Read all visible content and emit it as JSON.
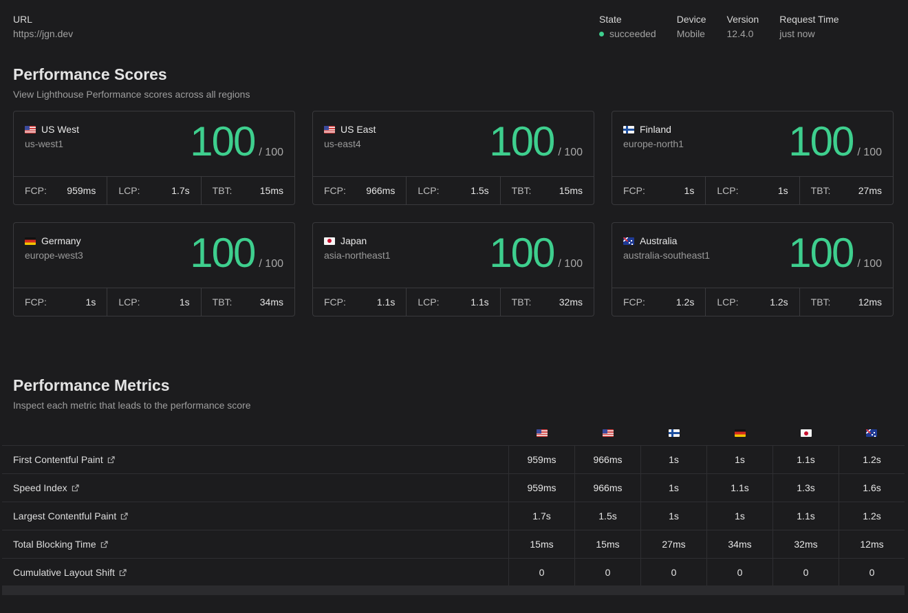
{
  "header": {
    "url_label": "URL",
    "url_value": "https://jgn.dev",
    "state_label": "State",
    "state_value": "succeeded",
    "device_label": "Device",
    "device_value": "Mobile",
    "version_label": "Version",
    "version_value": "12.4.0",
    "request_time_label": "Request Time",
    "request_time_value": "just now"
  },
  "scores_section": {
    "title": "Performance Scores",
    "subtitle": "View Lighthouse Performance scores across all regions",
    "max_suffix": "/ 100",
    "fcp_label": "FCP:",
    "lcp_label": "LCP:",
    "tbt_label": "TBT:",
    "regions": [
      {
        "name": "US West",
        "code": "us-west1",
        "flag": "flag-us",
        "score": "100",
        "fcp": "959ms",
        "lcp": "1.7s",
        "tbt": "15ms"
      },
      {
        "name": "US East",
        "code": "us-east4",
        "flag": "flag-us",
        "score": "100",
        "fcp": "966ms",
        "lcp": "1.5s",
        "tbt": "15ms"
      },
      {
        "name": "Finland",
        "code": "europe-north1",
        "flag": "flag-fi",
        "score": "100",
        "fcp": "1s",
        "lcp": "1s",
        "tbt": "27ms"
      },
      {
        "name": "Germany",
        "code": "europe-west3",
        "flag": "flag-de",
        "score": "100",
        "fcp": "1s",
        "lcp": "1s",
        "tbt": "34ms"
      },
      {
        "name": "Japan",
        "code": "asia-northeast1",
        "flag": "flag-jp",
        "score": "100",
        "fcp": "1.1s",
        "lcp": "1.1s",
        "tbt": "32ms"
      },
      {
        "name": "Australia",
        "code": "australia-southeast1",
        "flag": "flag-au",
        "score": "100",
        "fcp": "1.2s",
        "lcp": "1.2s",
        "tbt": "12ms"
      }
    ]
  },
  "metrics_section": {
    "title": "Performance Metrics",
    "subtitle": "Inspect each metric that leads to the performance score",
    "column_flags": [
      "flag-us",
      "flag-us",
      "flag-fi",
      "flag-de",
      "flag-jp",
      "flag-au"
    ],
    "rows": [
      {
        "label": "First Contentful Paint",
        "values": [
          "959ms",
          "966ms",
          "1s",
          "1s",
          "1.1s",
          "1.2s"
        ]
      },
      {
        "label": "Speed Index",
        "values": [
          "959ms",
          "966ms",
          "1s",
          "1.1s",
          "1.3s",
          "1.6s"
        ]
      },
      {
        "label": "Largest Contentful Paint",
        "values": [
          "1.7s",
          "1.5s",
          "1s",
          "1s",
          "1.1s",
          "1.2s"
        ]
      },
      {
        "label": "Total Blocking Time",
        "values": [
          "15ms",
          "15ms",
          "27ms",
          "34ms",
          "32ms",
          "12ms"
        ]
      },
      {
        "label": "Cumulative Layout Shift",
        "values": [
          "0",
          "0",
          "0",
          "0",
          "0",
          "0"
        ]
      }
    ]
  },
  "colors": {
    "accent": "#3ecf8e",
    "background": "#1c1c1e",
    "border": "#3a3a3d"
  }
}
